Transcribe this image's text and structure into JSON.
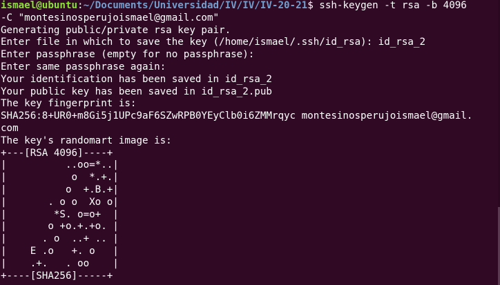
{
  "prompt": {
    "user_host": "ismael@ubuntu",
    "colon": ":",
    "path": "~/Documents/Universidad/IV/IV/IV-20-21",
    "symbol": "$ ",
    "command": "ssh-keygen -t rsa -b 4096"
  },
  "lines": [
    "-C \"montesinosperujoismael@gmail.com\"",
    "Generating public/private rsa key pair.",
    "Enter file in which to save the key (/home/ismael/.ssh/id_rsa): id_rsa_2",
    "Enter passphrase (empty for no passphrase):",
    "Enter same passphrase again:",
    "Your identification has been saved in id_rsa_2",
    "Your public key has been saved in id_rsa_2.pub",
    "The key fingerprint is:",
    "SHA256:8+UR0+m8Gi5j1UPc9aF6SZwRPB0YEyClb0i6ZMMrqyc montesinosperujoismael@gmail.",
    "com",
    "The key's randomart image is:"
  ],
  "randomart": [
    "+---[RSA 4096]----+",
    "|          ..oo=*..|",
    "|           o  *.+.|",
    "|          o  +.B.+|",
    "|       . o o  Xo o|",
    "|        *S. o=o+  |",
    "|       o +o.+.+o. |",
    "|      . o  ..+ .. |",
    "|    E .o   +. o   |",
    "|    .+.   . oo    |",
    "+----[SHA256]-----+"
  ],
  "colors": {
    "background": "#300a24",
    "foreground": "#ffffff",
    "user_host": "#8ae234",
    "path": "#729fcf"
  }
}
